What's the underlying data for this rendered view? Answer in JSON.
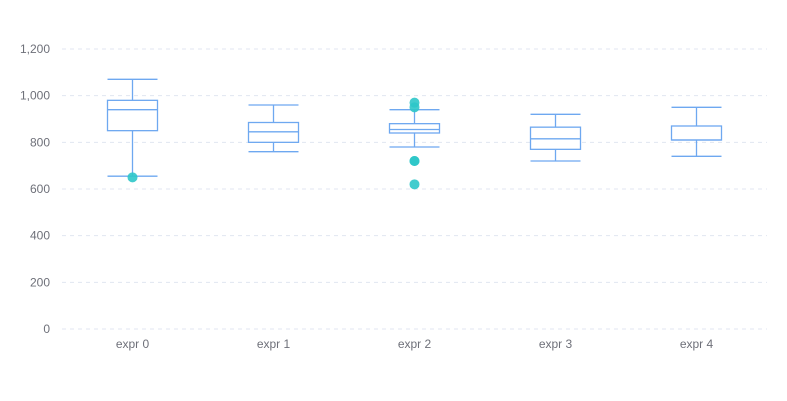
{
  "chart_data": {
    "type": "boxplot",
    "categories": [
      "expr 0",
      "expr 1",
      "expr 2",
      "expr 3",
      "expr 4"
    ],
    "y_ticks": [
      "0",
      "200",
      "400",
      "600",
      "800",
      "1,000",
      "1,200"
    ],
    "ylim": [
      0,
      1200
    ],
    "grid": true,
    "box_color": "#5470c6",
    "box_stroke_color": "#6ea8f0",
    "outlier_color": "#2ec7c9",
    "boxes": [
      {
        "category": "expr 0",
        "min": 655,
        "q1": 850,
        "median": 940,
        "q3": 980,
        "max": 1070,
        "outliers": [
          650
        ]
      },
      {
        "category": "expr 1",
        "min": 760,
        "q1": 800,
        "median": 845,
        "q3": 885,
        "max": 960,
        "outliers": []
      },
      {
        "category": "expr 2",
        "min": 780,
        "q1": 840,
        "median": 855,
        "q3": 880,
        "max": 940,
        "outliers": [
          970,
          950,
          720,
          720,
          620
        ]
      },
      {
        "category": "expr 3",
        "min": 720,
        "q1": 770,
        "median": 815,
        "q3": 865,
        "max": 920,
        "outliers": []
      },
      {
        "category": "expr 4",
        "min": 740,
        "q1": 810,
        "median": 810,
        "q3": 870,
        "max": 950,
        "outliers": []
      }
    ]
  }
}
